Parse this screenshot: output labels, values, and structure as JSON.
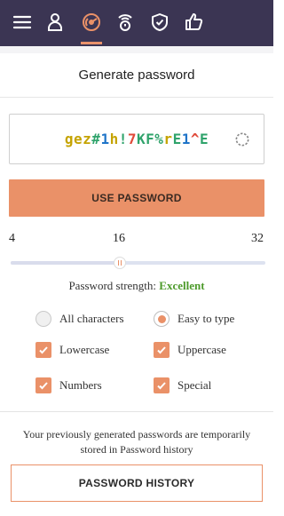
{
  "colors": {
    "topbar": "#3b3553",
    "accent": "#ea9168",
    "strength_good": "#4c9a2a",
    "pw_letter": "#c5a300",
    "pw_digit": "#1f74c8",
    "pw_symbol": "#2fa36b",
    "pw_upper": "#e04a3a"
  },
  "nav": {
    "items": [
      {
        "name": "menu-icon"
      },
      {
        "name": "user-icon"
      },
      {
        "name": "password-generator-icon",
        "active": true
      },
      {
        "name": "timer-icon"
      },
      {
        "name": "shield-icon"
      },
      {
        "name": "thumbs-up-icon"
      }
    ]
  },
  "header": {
    "title": "Generate password"
  },
  "password": {
    "value": "gez#1h!7KF%rE1^E",
    "chars": [
      {
        "c": "g",
        "t": "l"
      },
      {
        "c": "e",
        "t": "l"
      },
      {
        "c": "z",
        "t": "l"
      },
      {
        "c": "#",
        "t": "s"
      },
      {
        "c": "1",
        "t": "d"
      },
      {
        "c": "h",
        "t": "l"
      },
      {
        "c": "!",
        "t": "s"
      },
      {
        "c": "7",
        "t": "u"
      },
      {
        "c": "K",
        "t": "s"
      },
      {
        "c": "F",
        "t": "s"
      },
      {
        "c": "%",
        "t": "s"
      },
      {
        "c": "r",
        "t": "l"
      },
      {
        "c": "E",
        "t": "s"
      },
      {
        "c": "1",
        "t": "d"
      },
      {
        "c": "^",
        "t": "u"
      },
      {
        "c": "E",
        "t": "s"
      }
    ],
    "refresh_icon": "refresh-icon"
  },
  "use_button": {
    "label": "USE PASSWORD"
  },
  "length": {
    "min_label": "4",
    "mid_label": "16",
    "max_label": "32",
    "value": 16,
    "min": 4,
    "max": 32
  },
  "strength": {
    "label": "Password strength:",
    "value": "Excellent"
  },
  "options": {
    "all_characters": {
      "label": "All characters",
      "selected": false
    },
    "easy_to_type": {
      "label": "Easy to type",
      "selected": true
    },
    "lowercase": {
      "label": "Lowercase",
      "checked": true
    },
    "uppercase": {
      "label": "Uppercase",
      "checked": true
    },
    "numbers": {
      "label": "Numbers",
      "checked": true
    },
    "special": {
      "label": "Special",
      "checked": true
    }
  },
  "history": {
    "note": "Your previously generated passwords are temporarily stored in Password history",
    "button_label": "PASSWORD HISTORY"
  }
}
